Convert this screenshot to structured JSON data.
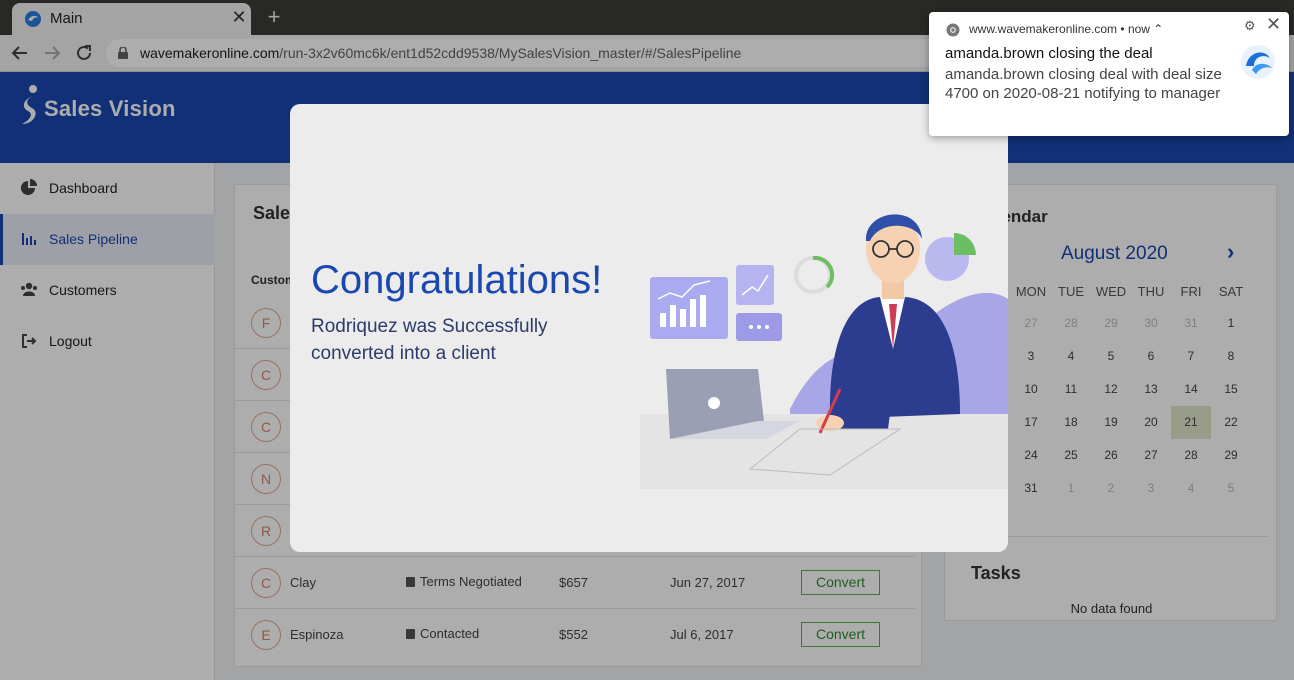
{
  "browser": {
    "tab_title": "Main",
    "url_host": "wavemakeronline.com",
    "url_path": "/run-3x2v60mc6k/ent1d52cdd9538/MySalesVision_master/#/SalesPipeline"
  },
  "app": {
    "logo_text": "Sales Vision",
    "sidebar": [
      {
        "label": "Dashboard",
        "icon": "pie-chart-icon"
      },
      {
        "label": "Sales Pipeline",
        "icon": "bar-chart-icon"
      },
      {
        "label": "Customers",
        "icon": "users-icon"
      },
      {
        "label": "Logout",
        "icon": "logout-icon"
      }
    ],
    "active_item": "Sales Pipeline"
  },
  "pipeline": {
    "title": "Sales Pipeline",
    "column_header": "Customer",
    "rows": [
      {
        "initial": "F"
      },
      {
        "initial": "C"
      },
      {
        "initial": "C"
      },
      {
        "initial": "N"
      },
      {
        "initial": "R"
      },
      {
        "initial": "C",
        "name": "Clay",
        "stage": "Terms Negotiated",
        "amount": "$657",
        "date": "Jun 27, 2017",
        "action": "Convert"
      },
      {
        "initial": "E",
        "name": "Espinoza",
        "stage": "Contacted",
        "amount": "$552",
        "date": "Jul 6, 2017",
        "action": "Convert"
      }
    ]
  },
  "calendar": {
    "title": "Calendar",
    "month": "August 2020",
    "next": "›",
    "weekdays": [
      "MON",
      "TUE",
      "WED",
      "THU",
      "FRI",
      "SAT"
    ],
    "weeks": [
      [
        "27",
        "28",
        "29",
        "30",
        "31",
        "1"
      ],
      [
        "3",
        "4",
        "5",
        "6",
        "7",
        "8"
      ],
      [
        "10",
        "11",
        "12",
        "13",
        "14",
        "15"
      ],
      [
        "17",
        "18",
        "19",
        "20",
        "21",
        "22"
      ],
      [
        "24",
        "25",
        "26",
        "27",
        "28",
        "29"
      ],
      [
        "31",
        "1",
        "2",
        "3",
        "4",
        "5"
      ]
    ],
    "today": "21"
  },
  "tasks": {
    "title": "Tasks",
    "empty_text": "No data found"
  },
  "modal": {
    "heading": "Congratulations!",
    "message": "Rodriquez was Successfully converted into a client"
  },
  "notification": {
    "source": "www.wavemakeronline.com",
    "time": "now",
    "title": "amanda.brown closing the deal",
    "body": "amanda.brown closing deal with deal size 4700 on 2020-08-21 notifying to manager"
  }
}
